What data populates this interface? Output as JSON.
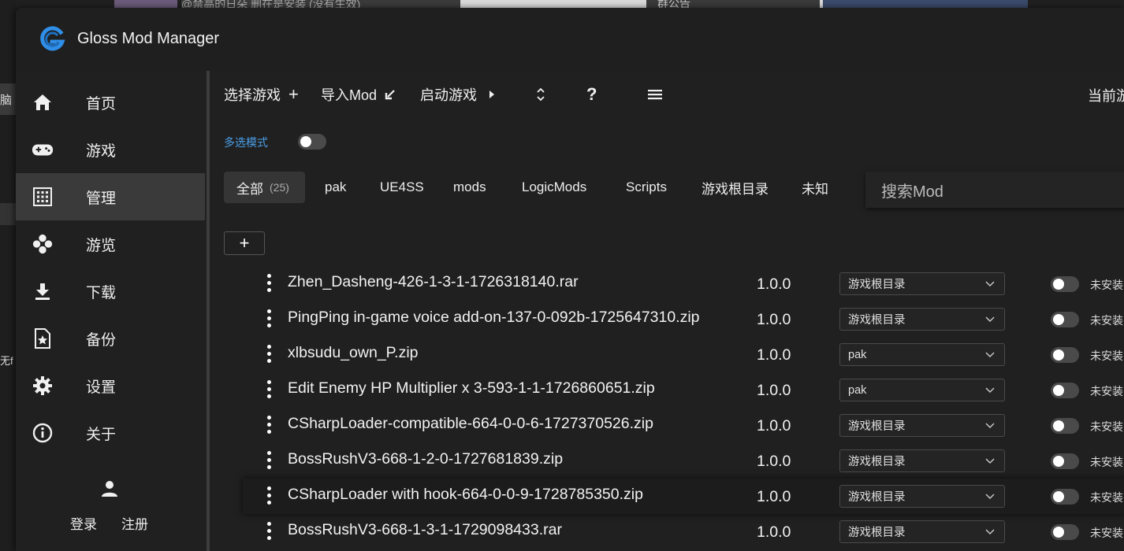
{
  "app": {
    "title": "Gloss Mod Manager"
  },
  "background": {
    "frag_top": "@禁高的日朵 删在是安装 (没有生效)",
    "frag_notice": "群公告",
    "frag_left1": "脑",
    "frag_left2": "无f"
  },
  "sidebar": {
    "items": [
      {
        "label": "首页",
        "icon": "home-icon"
      },
      {
        "label": "游戏",
        "icon": "gamepad-icon"
      },
      {
        "label": "管理",
        "icon": "grid-icon",
        "active": true
      },
      {
        "label": "游览",
        "icon": "browse-icon"
      },
      {
        "label": "下载",
        "icon": "download-icon"
      },
      {
        "label": "备份",
        "icon": "backup-file-icon"
      },
      {
        "label": "设置",
        "icon": "gear-icon"
      },
      {
        "label": "关于",
        "icon": "info-icon"
      }
    ],
    "login": "登录",
    "register": "注册"
  },
  "toolbar": {
    "select_game": "选择游戏",
    "import_mod": "导入Mod",
    "launch_game": "启动游戏",
    "help": "?",
    "current_game": "当前游"
  },
  "multi_select": {
    "label": "多选模式",
    "on": false
  },
  "tabs": {
    "all": {
      "label": "全部",
      "count": "(25)"
    },
    "items": [
      "pak",
      "UE4SS",
      "mods",
      "LogicMods",
      "Scripts",
      "游戏根目录",
      "未知"
    ]
  },
  "search": {
    "placeholder": "搜索Mod"
  },
  "add_button": "+",
  "mods": [
    {
      "name": "Zhen_Dasheng-426-1-3-1-1726318140.rar",
      "version": "1.0.0",
      "type": "游戏根目录",
      "status": "未安装",
      "installed": false
    },
    {
      "name": "PingPing in-game voice add-on-137-0-092b-1725647310.zip",
      "version": "1.0.0",
      "type": "游戏根目录",
      "status": "未安装",
      "installed": false
    },
    {
      "name": "xlbsudu_own_P.zip",
      "version": "1.0.0",
      "type": "pak",
      "status": "未安装",
      "installed": false
    },
    {
      "name": "Edit Enemy HP Multiplier x 3-593-1-1-1726860651.zip",
      "version": "1.0.0",
      "type": "pak",
      "status": "未安装",
      "installed": false
    },
    {
      "name": "CSharpLoader-compatible-664-0-0-6-1727370526.zip",
      "version": "1.0.0",
      "type": "游戏根目录",
      "status": "未安装",
      "installed": false
    },
    {
      "name": "BossRushV3-668-1-2-0-1727681839.zip",
      "version": "1.0.0",
      "type": "游戏根目录",
      "status": "未安装",
      "installed": false
    },
    {
      "name": "CSharpLoader with hook-664-0-0-9-1728785350.zip",
      "version": "1.0.0",
      "type": "游戏根目录",
      "status": "未安装",
      "installed": false
    },
    {
      "name": "BossRushV3-668-1-3-1-1729098433.rar",
      "version": "1.0.0",
      "type": "游戏根目录",
      "status": "未安装",
      "installed": false
    }
  ],
  "colors": {
    "accent": "#4a9fe8",
    "active_nav": "#3a3a3a",
    "logo_blue": "#2f8fe8"
  }
}
